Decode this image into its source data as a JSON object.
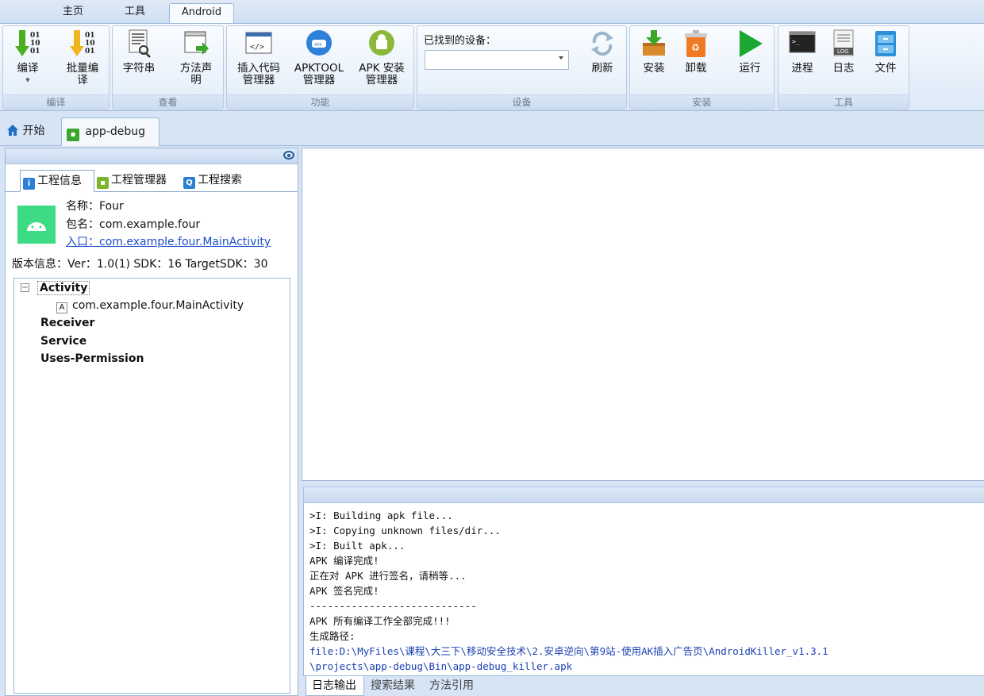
{
  "ribbon_tabs": [
    "主页",
    "工具",
    "Android"
  ],
  "ribbon": {
    "compile_group": {
      "label": "编译",
      "buttons": [
        "编译",
        "批量编\n译"
      ]
    },
    "view_group": {
      "label": "查看",
      "buttons": [
        "字符串",
        "方法声\n明"
      ]
    },
    "function_group": {
      "label": "功能",
      "buttons": [
        "插入代码\n管理器",
        "APKTOOL\n管理器",
        "APK 安装\n管理器"
      ]
    },
    "device_group": {
      "label": "设备",
      "found_devices_label": "已找到的设备：",
      "device_value": "",
      "refresh": "刷新"
    },
    "install_group": {
      "label": "安装",
      "buttons": [
        "安装",
        "卸载",
        "运行"
      ]
    },
    "tools_group": {
      "label": "工具",
      "buttons": [
        "进程",
        "日志",
        "文件"
      ]
    }
  },
  "doc_tabs": [
    "开始",
    "app-debug"
  ],
  "left_panel": {
    "tabs": [
      "工程信息",
      "工程管理器",
      "工程搜索"
    ],
    "info": {
      "name": "名称：Four",
      "package": "包名：com.example.four",
      "entry": "入口：com.example.four.MainActivity",
      "version": "版本信息：Ver：1.0(1) SDK：16 TargetSDK：30"
    },
    "tree": {
      "activity": "Activity",
      "activity_child": "com.example.four.MainActivity",
      "receiver": "Receiver",
      "service": "Service",
      "uses_permission": "Uses-Permission"
    }
  },
  "log": {
    "lines": [
      ">I: Building apk file...",
      ">I: Copying unknown files/dir...",
      ">I: Built apk...",
      "APK 编译完成!",
      "正在对 APK 进行签名，请稍等...",
      "APK 签名完成!",
      "----------------------------",
      "APK 所有编译工作全部完成!!!",
      "生成路径:"
    ],
    "path_lines": [
      "file:D:\\MyFiles\\课程\\大三下\\移动安全技术\\2.安卓逆向\\第9站-使用AK插入广告页\\AndroidKiller_v1.3.1",
      "\\projects\\app-debug\\Bin\\app-debug_killer.apk"
    ]
  },
  "bottom_tabs": [
    "日志输出",
    "搜索结果",
    "方法引用"
  ],
  "colors": {
    "accent_blue": "#1a4ccc",
    "android_green": "#3ddc84",
    "run_green": "#1aa832"
  }
}
